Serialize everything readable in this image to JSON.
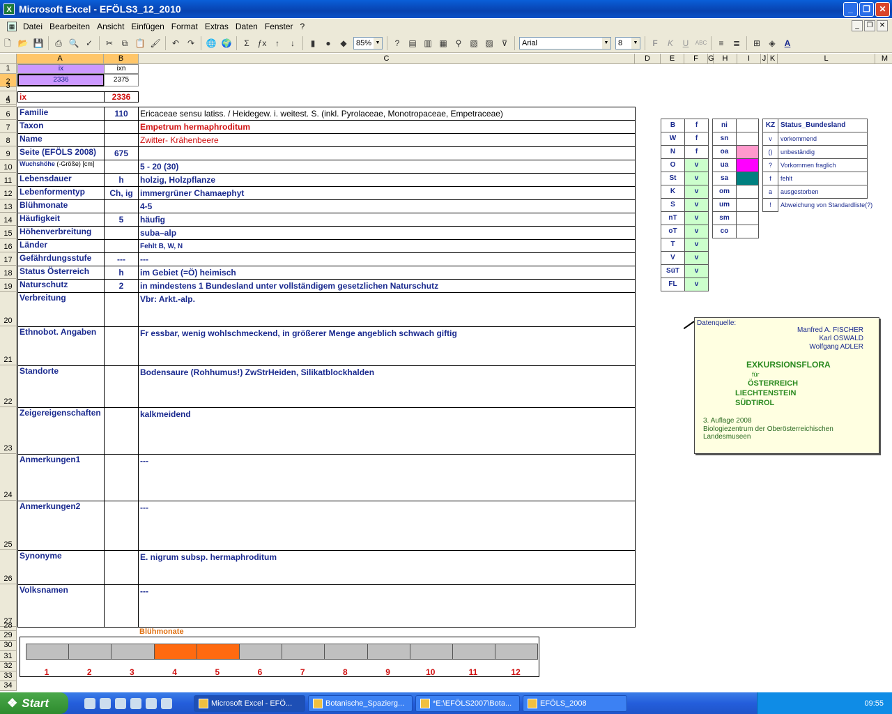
{
  "window": {
    "title": "Microsoft Excel - EFÖLS3_12_2010"
  },
  "menu": [
    "Datei",
    "Bearbeiten",
    "Ansicht",
    "Einfügen",
    "Format",
    "Extras",
    "Daten",
    "Fenster",
    "?"
  ],
  "toolbar": {
    "zoom": "85%",
    "font": "Arial",
    "size": "8"
  },
  "columns": [
    "A",
    "B",
    "C",
    "D",
    "E",
    "F",
    "G",
    "H",
    "I",
    "J",
    "K",
    "L",
    "M"
  ],
  "rows": [
    "1",
    "2",
    "3",
    "4",
    "5",
    "6",
    "7",
    "8",
    "9",
    "10",
    "11",
    "12",
    "13",
    "14",
    "15",
    "16",
    "17",
    "18",
    "19",
    "20",
    "21",
    "22",
    "23",
    "24",
    "25",
    "26",
    "27",
    "28",
    "29",
    "30",
    "31",
    "32",
    "33",
    "34"
  ],
  "header": {
    "a1": "ix",
    "b1": "ixn",
    "a2": "2336",
    "b2": "2375",
    "a4": "ix",
    "b4": "2336"
  },
  "records": [
    {
      "label": "Familie",
      "value": "110",
      "text": "Ericaceae sensu latiss.  /  Heidegew. i. weitest. S. (inkl. Pyrolaceae, Monotropaceae, Empetraceae)"
    },
    {
      "label": "Taxon",
      "value": "",
      "text": "Empetrum hermaphroditum"
    },
    {
      "label": "Name",
      "value": "",
      "text": "Zwitter- Krähenbeere"
    },
    {
      "label": "Seite (EFÖLS 2008)",
      "value": "675",
      "text": ""
    },
    {
      "label": "Wuchshöhe",
      "label2": "(-Größe) [cm]",
      "value": "",
      "text": " 5 - 20 (30)"
    },
    {
      "label": "Lebensdauer",
      "value": "h",
      "text": "holzig, Holzpflanze"
    },
    {
      "label": "Lebenformentyp",
      "value": "Ch, ig",
      "text": "immergrüner Chamaephyt"
    },
    {
      "label": "Blühmonate",
      "value": "",
      "text": " 4-5"
    },
    {
      "label": "Häufigkeit",
      "value": "5",
      "text": "häufig"
    },
    {
      "label": "Höhenverbreitung",
      "value": "",
      "text": "suba–alp"
    },
    {
      "label": "Länder",
      "value": "",
      "text": "Fehlt B, W, N"
    },
    {
      "label": "Gefährdungsstufe",
      "value": "---",
      "text": "   ---"
    },
    {
      "label": "Status Österreich",
      "value": "h",
      "text": "im Gebiet (=Ö) heimisch"
    },
    {
      "label": "Naturschutz",
      "value": "2",
      "text": "in mindestens 1 Bundesland unter vollständigem gesetzlichen Naturschutz"
    },
    {
      "label": "Verbreitung",
      "value": "",
      "text": "Vbr: Arkt.-alp."
    },
    {
      "label": "Ethnobot. Angaben",
      "value": "",
      "text": "Fr essbar, wenig wohlschmeckend, in größerer Menge angeblich schwach giftig"
    },
    {
      "label": "Standorte",
      "value": "",
      "text": "Bodensaure (Rohhumus!) ZwStrHeiden, Silikatblockhalden"
    },
    {
      "label": "Zeigereigenschaften",
      "value": "",
      "text": "kalkmeidend"
    },
    {
      "label": "Anmerkungen1",
      "value": "",
      "text": "---"
    },
    {
      "label": "Anmerkungen2",
      "value": "",
      "text": "---"
    },
    {
      "label": "Synonyme",
      "value": "",
      "text": "E. nigrum subsp. hermaphroditum"
    },
    {
      "label": "Volksnamen",
      "value": "",
      "text": "---"
    }
  ],
  "states": [
    {
      "code": "B",
      "val": "f"
    },
    {
      "code": "W",
      "val": "f"
    },
    {
      "code": "N",
      "val": "f"
    },
    {
      "code": "O",
      "val": "v"
    },
    {
      "code": "St",
      "val": "v"
    },
    {
      "code": "K",
      "val": "v"
    },
    {
      "code": "S",
      "val": "v"
    },
    {
      "code": "nT",
      "val": "v"
    },
    {
      "code": "oT",
      "val": "v"
    },
    {
      "code": "T",
      "val": "v"
    },
    {
      "code": "V",
      "val": "v"
    },
    {
      "code": "SüT",
      "val": "v"
    },
    {
      "code": "FL",
      "val": "v"
    }
  ],
  "altitude": [
    {
      "code": "ni",
      "color": "#ffffff"
    },
    {
      "code": "sn",
      "color": "#ffffff"
    },
    {
      "code": "oa",
      "color": "#ff99cc"
    },
    {
      "code": "ua",
      "color": "#ff00ff"
    },
    {
      "code": "sa",
      "color": "#008080"
    },
    {
      "code": "om",
      "color": "#ffffff"
    },
    {
      "code": "um",
      "color": "#ffffff"
    },
    {
      "code": "sm",
      "color": "#ffffff"
    },
    {
      "code": "co",
      "color": "#ffffff"
    }
  ],
  "legend": {
    "kz": "KZ",
    "title": "Status_Bundesland",
    "items": [
      {
        "k": "v",
        "t": "vorkommend"
      },
      {
        "k": "()",
        "t": "unbeständig"
      },
      {
        "k": "?",
        "t": "Vorkommen fraglich"
      },
      {
        "k": "f",
        "t": "fehlt"
      },
      {
        "k": "a",
        "t": "ausgestorben"
      },
      {
        "k": "!",
        "t": "Abweichung von Standardliste(?)"
      }
    ]
  },
  "source": {
    "head": "Datenquelle:",
    "a1": "Manfred A. FISCHER",
    "a2": "Karl OSWALD",
    "a3": "Wolfgang ADLER",
    "t1": "EXKURSIONSFLORA",
    "t2": "für",
    "t3": "ÖSTERREICH",
    "t4": "LIECHTENSTEIN",
    "t5": "SÜDTIROL",
    "e1": "3. Auflage 2008",
    "e2": "Biologiezentrum der Oberösterreichischen Landesmuseen"
  },
  "bloom": {
    "title": "Blühmonate",
    "months": [
      "1",
      "2",
      "3",
      "4",
      "5",
      "6",
      "7",
      "8",
      "9",
      "10",
      "11",
      "12"
    ],
    "active": [
      4,
      5
    ]
  },
  "taskbar": {
    "start": "Start",
    "tasks": [
      "Microsoft Excel - EFÖ...",
      "Botanische_Spazierg...",
      "*E:\\EFÖLS2007\\Bota...",
      "EFÖLS_2008"
    ],
    "clock": "09:55"
  },
  "colors": {
    "purple": "#cc99ff",
    "green": "#ccffcc",
    "orange": "#ff6a10"
  }
}
